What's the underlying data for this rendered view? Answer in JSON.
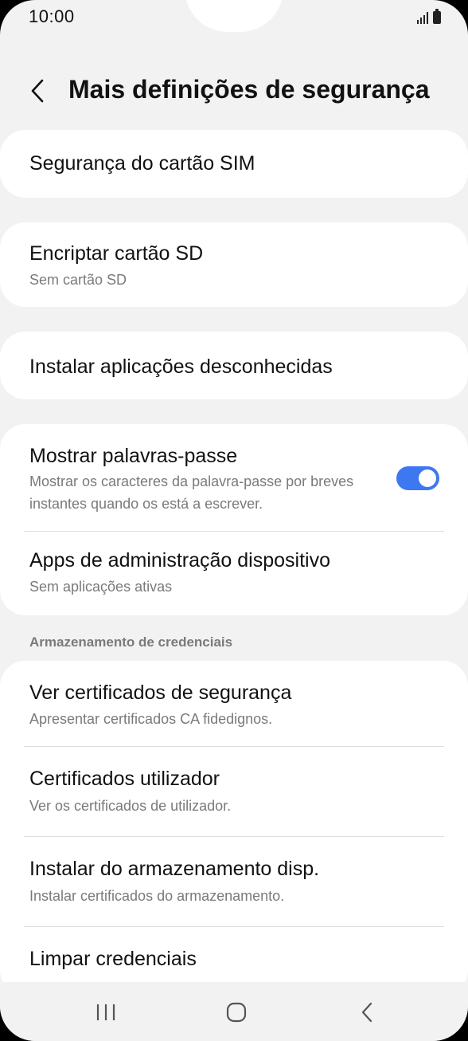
{
  "status_bar": {
    "time": "10:00",
    "signal_icon": "signal-bars-icon",
    "battery_icon": "battery-icon"
  },
  "header": {
    "back_icon": "chevron-left-icon",
    "title": "Mais definições de segurança"
  },
  "items": {
    "sim_security": {
      "title": "Segurança do cartão SIM"
    },
    "encrypt_sd": {
      "title": "Encriptar cartão SD",
      "subtitle": "Sem cartão SD"
    },
    "unknown_apps": {
      "title": "Instalar aplicações desconhecidas"
    },
    "show_passwords": {
      "title": "Mostrar palavras-passe",
      "subtitle": "Mostrar os caracteres da palavra-passe por breves instantes quando os está a escrever.",
      "toggle_on": true
    },
    "device_admin": {
      "title": "Apps de administração dispositivo",
      "subtitle": "Sem aplicações ativas"
    }
  },
  "credentials": {
    "section_label": "Armazenamento de credenciais",
    "view_certs": {
      "title": "Ver certificados de segurança",
      "subtitle": "Apresentar certificados CA fidedignos."
    },
    "user_certs": {
      "title": "Certificados utilizador",
      "subtitle": "Ver os certificados de utilizador."
    },
    "install_storage": {
      "title": "Instalar do armazenamento disp.",
      "subtitle": "Instalar certificados do armazenamento."
    },
    "clear_credentials": {
      "title": "Limpar credenciais"
    }
  },
  "nav_bar": {
    "recents_icon": "recents-icon",
    "home_icon": "home-icon",
    "back_icon": "back-icon"
  },
  "colors": {
    "background": "#f2f2f2",
    "card": "#ffffff",
    "accent": "#3e78f0",
    "secondary_text": "#7a7a7a"
  }
}
